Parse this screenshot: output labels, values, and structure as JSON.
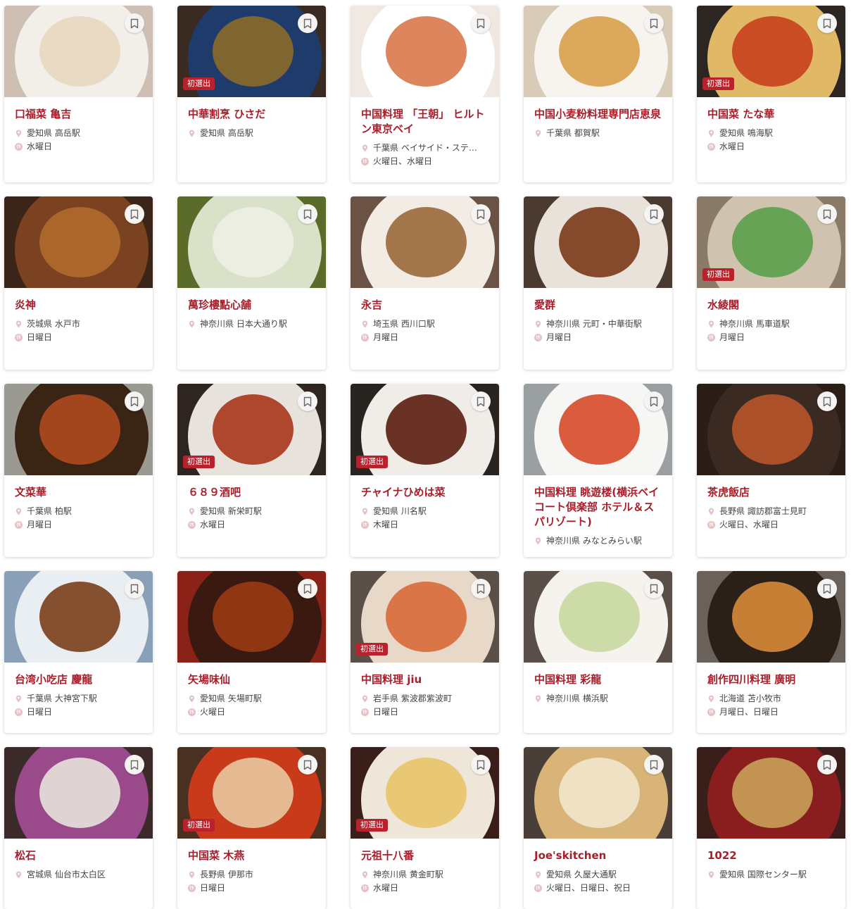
{
  "colors": {
    "accent": "#a81e2a",
    "badge": "#b7222c"
  },
  "icons": {
    "bookmark": "bookmark-icon",
    "location": "location-pin-icon",
    "holiday": "holiday-icon"
  },
  "holiday_glyph": "休",
  "cards": [
    {
      "name": "口福菜 亀吉",
      "location": "愛知県 高岳駅",
      "closed": "水曜日",
      "badge": ""
    },
    {
      "name": "中華割烹 ひさだ",
      "location": "愛知県 高岳駅",
      "closed": "",
      "badge": "初選出"
    },
    {
      "name": "中国料理 「王朝」 ヒルトン東京ベイ",
      "location": "千葉県 ベイサイド・ステ…",
      "closed": "火曜日、水曜日",
      "badge": ""
    },
    {
      "name": "中国小麦粉料理専門店恵泉",
      "location": "千葉県 都賀駅",
      "closed": "",
      "badge": ""
    },
    {
      "name": "中国菜 たな華",
      "location": "愛知県 鳴海駅",
      "closed": "水曜日",
      "badge": "初選出"
    },
    {
      "name": "炎神",
      "location": "茨城県 水戸市",
      "closed": "日曜日",
      "badge": ""
    },
    {
      "name": "萬珍樓點心舗",
      "location": "神奈川県 日本大通り駅",
      "closed": "",
      "badge": ""
    },
    {
      "name": "永吉",
      "location": "埼玉県 西川口駅",
      "closed": "月曜日",
      "badge": ""
    },
    {
      "name": "愛群",
      "location": "神奈川県 元町・中華街駅",
      "closed": "月曜日",
      "badge": ""
    },
    {
      "name": "水綾閣",
      "location": "神奈川県 馬車道駅",
      "closed": "月曜日",
      "badge": "初選出"
    },
    {
      "name": "文菜華",
      "location": "千葉県 柏駅",
      "closed": "月曜日",
      "badge": ""
    },
    {
      "name": "６８９酒吧",
      "location": "愛知県 新栄町駅",
      "closed": "水曜日",
      "badge": "初選出"
    },
    {
      "name": "チャイナひめは菜",
      "location": "愛知県 川名駅",
      "closed": "木曜日",
      "badge": "初選出"
    },
    {
      "name": "中国料理 眺遊楼(横浜ベイコート倶楽部 ホテル＆スパリゾート)",
      "location": "神奈川県 みなとみらい駅",
      "closed": "",
      "badge": ""
    },
    {
      "name": "茶虎飯店",
      "location": "長野県 諏訪郡富士見町",
      "closed": "火曜日、水曜日",
      "badge": ""
    },
    {
      "name": "台湾小吃店 慶龍",
      "location": "千葉県 大神宮下駅",
      "closed": "日曜日",
      "badge": ""
    },
    {
      "name": "矢場味仙",
      "location": "愛知県 矢場町駅",
      "closed": "火曜日",
      "badge": ""
    },
    {
      "name": "中国料理 jiu",
      "location": "岩手県 紫波郡紫波町",
      "closed": "日曜日",
      "badge": "初選出"
    },
    {
      "name": "中国料理 彩龍",
      "location": "神奈川県 横浜駅",
      "closed": "",
      "badge": ""
    },
    {
      "name": "創作四川料理 廣明",
      "location": "北海道 苫小牧市",
      "closed": "月曜日、日曜日",
      "badge": ""
    },
    {
      "name": "松石",
      "location": "宮城県 仙台市太白区",
      "closed": "",
      "badge": ""
    },
    {
      "name": "中国菜 木燕",
      "location": "長野県 伊那市",
      "closed": "日曜日",
      "badge": "初選出"
    },
    {
      "name": "元祖十八番",
      "location": "神奈川県 黄金町駅",
      "closed": "水曜日",
      "badge": "初選出"
    },
    {
      "name": "Joe'skitchen",
      "location": "愛知県 久屋大通駅",
      "closed": "火曜日、日曜日、祝日",
      "badge": ""
    },
    {
      "name": "1022",
      "location": "愛知県 国際センター駅",
      "closed": "",
      "badge": ""
    }
  ]
}
